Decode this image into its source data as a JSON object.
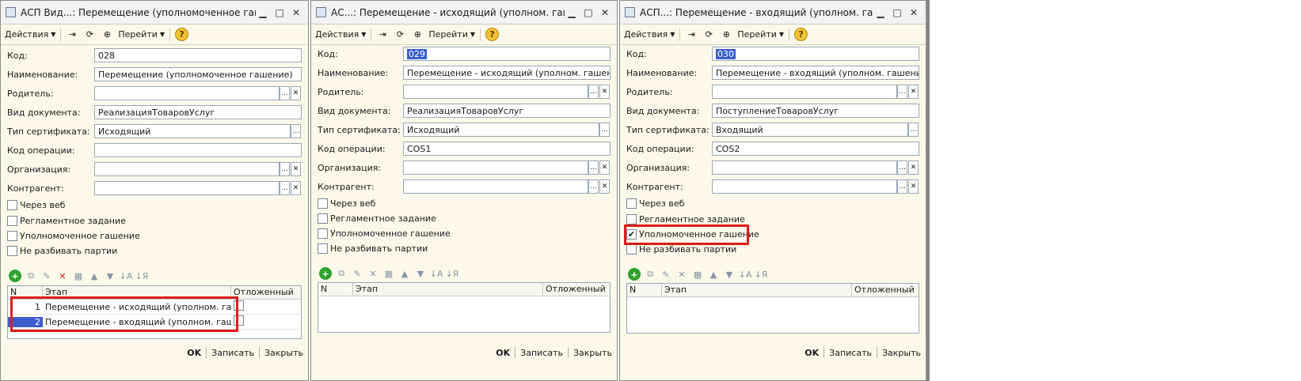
{
  "common": {
    "actions_label": "Действия",
    "goto_label": "Перейти",
    "help_glyph": "?",
    "labels": {
      "kod": "Код:",
      "naimenovanie": "Наименование:",
      "roditel": "Родитель:",
      "vid_dokumenta": "Вид документа:",
      "tip_sertifikata": "Тип сертификата:",
      "kod_operacii": "Код операции:",
      "organizaciya": "Организация:",
      "kontragent": "Контрагент:"
    },
    "checkboxes": {
      "cherez_veb": "Через веб",
      "reglament": "Регламентное задание",
      "upolnom": "Уполномоченное гашение",
      "ne_razbivat": "Не разбивать партии"
    },
    "table_headers": {
      "n": "N",
      "etap": "Этап",
      "otlozhenny": "Отложенный"
    },
    "footer": {
      "ok": "OK",
      "save": "Записать",
      "close": "Закрыть"
    },
    "select_btn": "...",
    "clear_btn": "✕"
  },
  "windows": [
    {
      "title": "АСП Вид...: Перемещение (уполномоченное гашение)",
      "kod": "028",
      "naimenovanie": "Перемещение (уполномоченное гашение)",
      "roditel": "",
      "vid_dokumenta": "РеализацияТоваровУслуг",
      "tip_sertifikata": "Исходящий",
      "kod_operacii": "",
      "organizaciya": "",
      "kontragent": "",
      "checks": {
        "cherez_veb": false,
        "reglament": false,
        "upolnom": false,
        "ne_razbivat": false
      },
      "rows": [
        {
          "n": "1",
          "etap": "Перемещение - исходящий (уполном. гашение)"
        },
        {
          "n": "2",
          "etap": "Перемещение - входящий (уполном. гашение)"
        }
      ]
    },
    {
      "title": "АС...: Перемещение - исходящий (уполном. гашение)",
      "kod": "029",
      "naimenovanie": "Перемещение - исходящий (уполном. гашение)",
      "roditel": "",
      "vid_dokumenta": "РеализацияТоваровУслуг",
      "tip_sertifikata": "Исходящий",
      "kod_operacii": "COS1",
      "organizaciya": "",
      "kontragent": "",
      "checks": {
        "cherez_veb": false,
        "reglament": false,
        "upolnom": false,
        "ne_razbivat": false
      },
      "rows": []
    },
    {
      "title": "АСП...: Перемещение - входящий (уполном. гашение)",
      "kod": "030",
      "naimenovanie": "Перемещение - входящий (уполном. гашение)",
      "roditel": "",
      "vid_dokumenta": "ПоступлениеТоваровУслуг",
      "tip_sertifikata": "Входящий",
      "kod_operacii": "COS2",
      "organizaciya": "",
      "kontragent": "",
      "checks": {
        "cherez_veb": false,
        "reglament": false,
        "upolnom": true,
        "ne_razbivat": false
      },
      "rows": []
    }
  ],
  "colors": {
    "highlight_red": "#e01b1b",
    "selection_blue": "#3a5fcd",
    "form_bg": "#fbf9ea"
  }
}
